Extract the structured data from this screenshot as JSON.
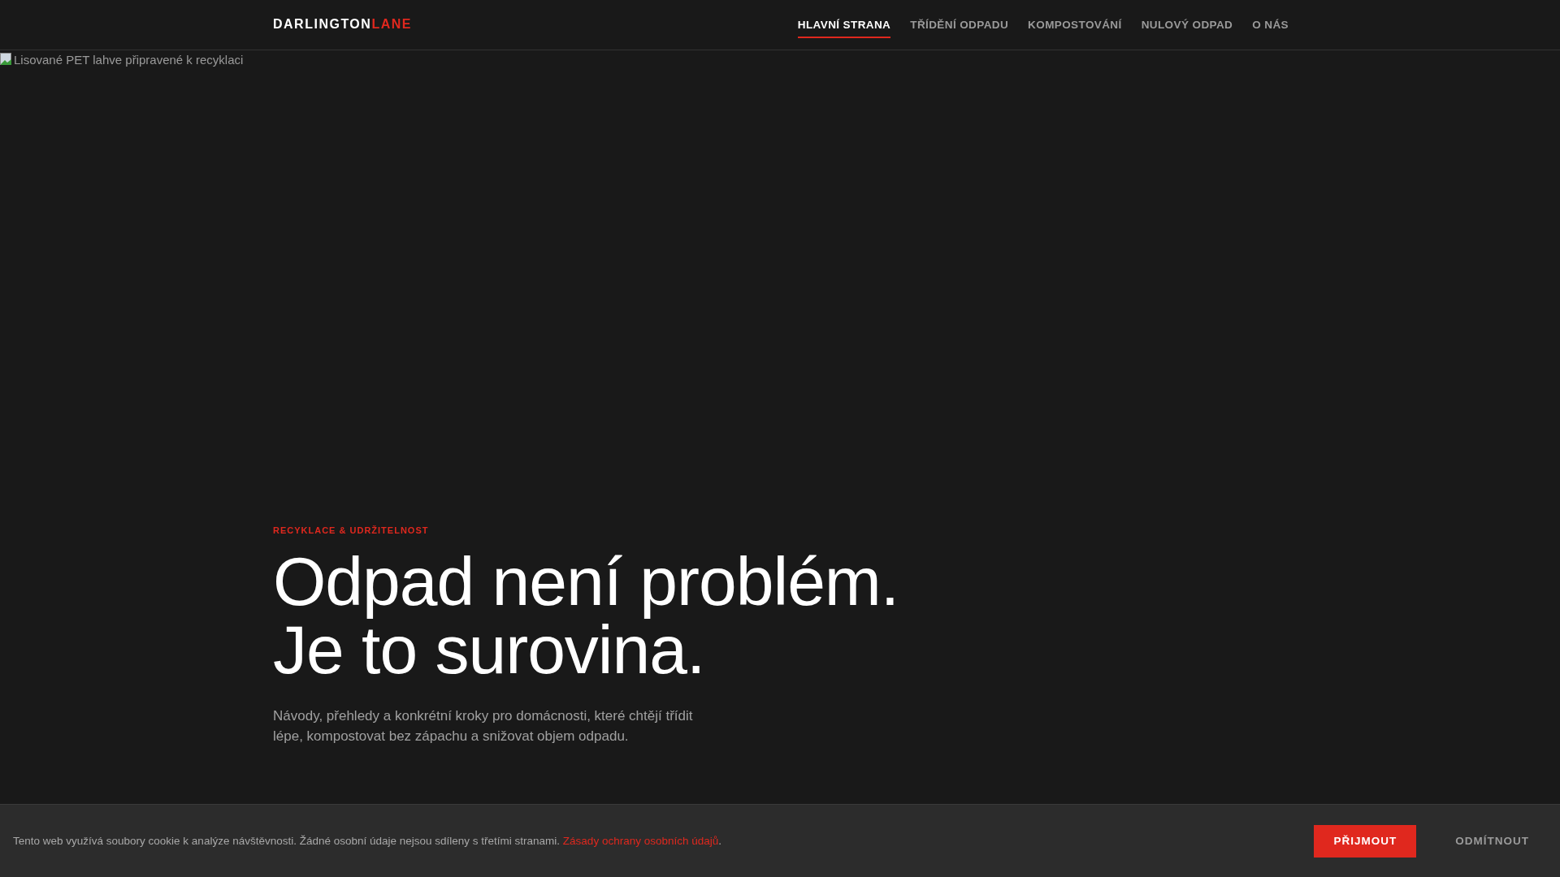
{
  "header": {
    "logo": {
      "main": "DARLINGTON",
      "accent": "LANE"
    },
    "nav": [
      {
        "label": "HLAVNÍ STRANA",
        "selected": true
      },
      {
        "label": "TŘÍDĚNÍ ODPADU",
        "selected": false
      },
      {
        "label": "KOMPOSTOVÁNÍ",
        "selected": false
      },
      {
        "label": "NULOVÝ ODPAD",
        "selected": false
      },
      {
        "label": "O NÁS",
        "selected": false
      }
    ]
  },
  "hero": {
    "image_alt": "Lisované PET lahve připravené k recyklaci",
    "eyebrow": "RECYKLACE & UDRŽITELNOST",
    "headline": [
      "Odpad není problém.",
      "Je to surovina."
    ],
    "lead": "Návody, přehledy a konkrétní kroky pro domácnosti, které chtějí třídit lépe, kompostovat bez zápachu a snižovat objem odpadu."
  },
  "cookie_bar": {
    "text": "Tento web využívá soubory cookie k analýze návštěvnosti. Žádné osobní údaje nejsou sdíleny s třetími stranami. ",
    "link": "Zásady ochrany osobních údajů",
    "suffix": ".",
    "buttons": [
      {
        "label": "PŘIJMOUT",
        "kind": "primary"
      },
      {
        "label": "ODMÍTNOUT",
        "kind": "secondary"
      }
    ]
  }
}
